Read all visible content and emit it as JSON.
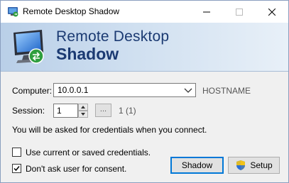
{
  "window": {
    "title": "Remote Desktop Shadow"
  },
  "titlebar": {
    "minimize": "—",
    "maximize": "☐",
    "close": "✕"
  },
  "banner": {
    "line1": "Remote Desktop",
    "line2": "Shadow"
  },
  "form": {
    "computer_label": "Computer:",
    "computer_value": "10.0.0.1",
    "hostname_label": "HOSTNAME",
    "session_label": "Session:",
    "session_value": "1",
    "browse_label": "...",
    "session_info": "1 (1)",
    "credentials_note": "You will be asked for credentials when you connect."
  },
  "options": [
    {
      "label": "Use current or saved credentials.",
      "checked": false
    },
    {
      "label": "Don't ask user for consent.",
      "checked": true
    }
  ],
  "buttons": {
    "shadow": "Shadow",
    "setup": "Setup"
  },
  "colors": {
    "banner_text": "#1b3a72",
    "focus_border": "#0078d7"
  }
}
